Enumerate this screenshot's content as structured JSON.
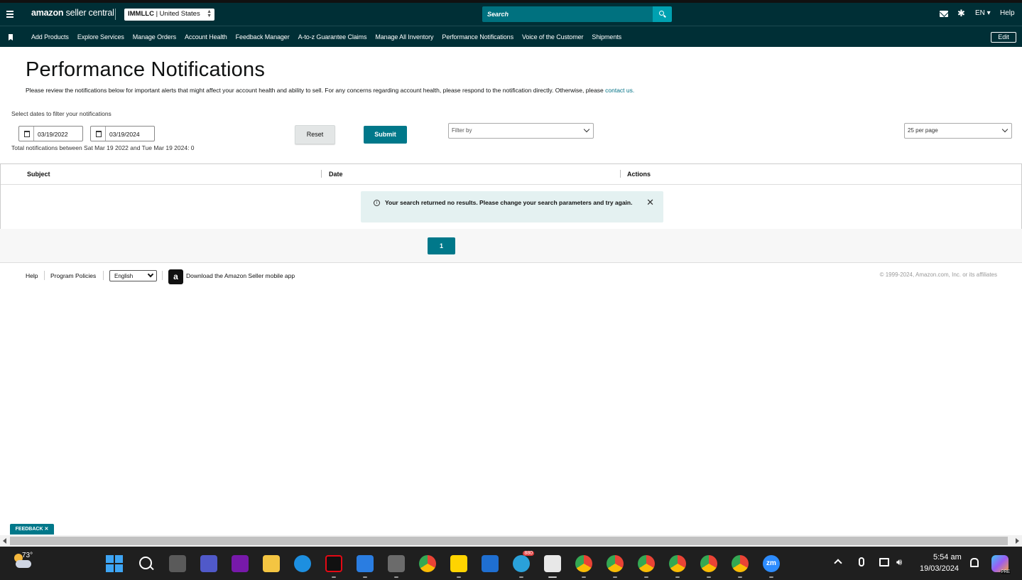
{
  "header": {
    "logo_bold": "amazon",
    "logo_rest": " seller central",
    "store_bold": "IMMLLC",
    "store_rest": " | United States",
    "search_placeholder": "Search",
    "language": "EN ▾",
    "help": "Help"
  },
  "nav": {
    "items": [
      "Add Products",
      "Explore Services",
      "Manage Orders",
      "Account Health",
      "Feedback Manager",
      "A-to-z Guarantee Claims",
      "Manage All Inventory",
      "Performance Notifications",
      "Voice of the Customer",
      "Shipments"
    ],
    "edit": "Edit"
  },
  "page": {
    "title": "Performance Notifications",
    "description": "Please review the notifications below for important alerts that might affect your account health and ability to sell. For any concerns regarding account health, please respond to the notification directly. Otherwise, please ",
    "contact_link": "contact us.",
    "select_dates_label": "Select dates to filter your notifications",
    "start_date": "03/19/2022",
    "end_date": "03/19/2024",
    "total_text": "Total notifications between Sat Mar 19 2022 and Tue Mar 19 2024: 0",
    "reset": "Reset",
    "submit": "Submit",
    "filter_placeholder": "Filter by",
    "per_page": "25 per page"
  },
  "table": {
    "columns": [
      "Subject",
      "Date",
      "Actions"
    ],
    "empty_message": "Your search returned no results. Please change your search parameters and try again."
  },
  "pagination": {
    "current_page": "1"
  },
  "footer": {
    "help": "Help",
    "program_policies": "Program Policies",
    "language": "English",
    "app_text": "Download the Amazon Seller mobile app",
    "copyright": "© 1999-2024, Amazon.com, Inc. or its affiliates"
  },
  "feedback": "FEEDBACK ✕",
  "taskbar": {
    "temperature": "73°",
    "telegram_badge": "880",
    "time": "5:54 am",
    "date": "19/03/2024"
  }
}
